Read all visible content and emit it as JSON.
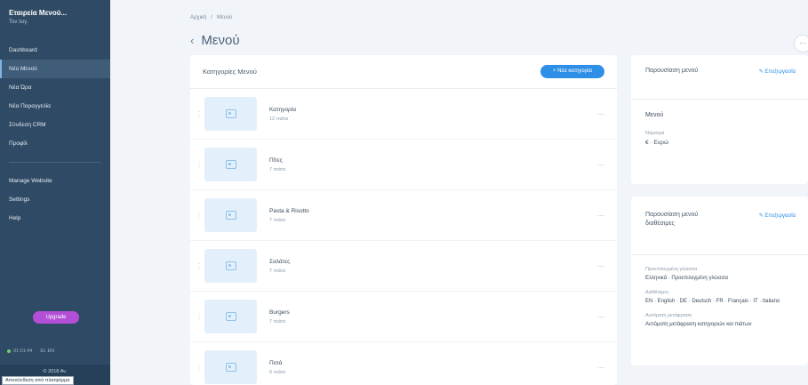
{
  "sidebar": {
    "brand_name": "Εταιρεία Μενού...",
    "brand_sub": "Τον λογ.",
    "items": [
      {
        "label": "Dashboard",
        "active": false
      },
      {
        "label": "Νέο Μενού",
        "active": true
      },
      {
        "label": "Νέα Ώρα",
        "active": false
      },
      {
        "label": "Νέα Παραγγελία",
        "active": false
      },
      {
        "label": "Σύνδεση CRM",
        "active": false
      },
      {
        "label": "Προφίλ",
        "active": false
      }
    ],
    "items2": [
      {
        "label": "Manage Website"
      },
      {
        "label": "Settings"
      },
      {
        "label": "Help"
      }
    ],
    "upgrade_label": "Upgrade",
    "status_text": "01:01:44",
    "status_extra": "EL EN",
    "footer_text": "© 2018 Αν.",
    "tooltip": "Αποσύνδεση από πλατφόρμα"
  },
  "header": {
    "breadcrumb": [
      "Αρχική",
      "/",
      "Μενού"
    ],
    "title": "Μενού",
    "back_icon": "‹",
    "corner_icon": "···"
  },
  "categories": {
    "title": "Κατηγορίες Μενού",
    "new_button": "+ Νέα κατηγορία",
    "rows": [
      {
        "name": "Κατηγορία",
        "count": "12 πιάτα"
      },
      {
        "name": "Πίτες",
        "count": "7 πιάτα"
      },
      {
        "name": "Pasta & Risotto",
        "count": "7 πιάτα"
      },
      {
        "name": "Σαλάτες",
        "count": "7 πιάτα"
      },
      {
        "name": "Burgers",
        "count": "7 πιάτα"
      },
      {
        "name": "Ποτά",
        "count": "6 πιάτα"
      }
    ]
  },
  "presentation": {
    "title": "Παρουσίαση μενού",
    "edit_label": "✎ Επεξεργασία",
    "value": "Μενού",
    "field_label": "Νόμισμα",
    "field_value": "€ · Ευρώ"
  },
  "translations": {
    "title": "Παρουσίαση μενού διαθέσιμες",
    "edit_label": "✎ Επεξεργασία",
    "fields": [
      {
        "label": "Προεπιλεγμένη γλώσσα",
        "value": "Ελληνικά · Προεπιλεγμένη γλώσσα"
      },
      {
        "label": "Διαθέσιμες",
        "value": "EN · English · DE · Deutsch · FR · Français · IT · Italiano"
      },
      {
        "label": "Αυτόματη μετάφραση",
        "value": "Αυτόματη μετάφραση κατηγοριών και πιάτων"
      }
    ]
  }
}
